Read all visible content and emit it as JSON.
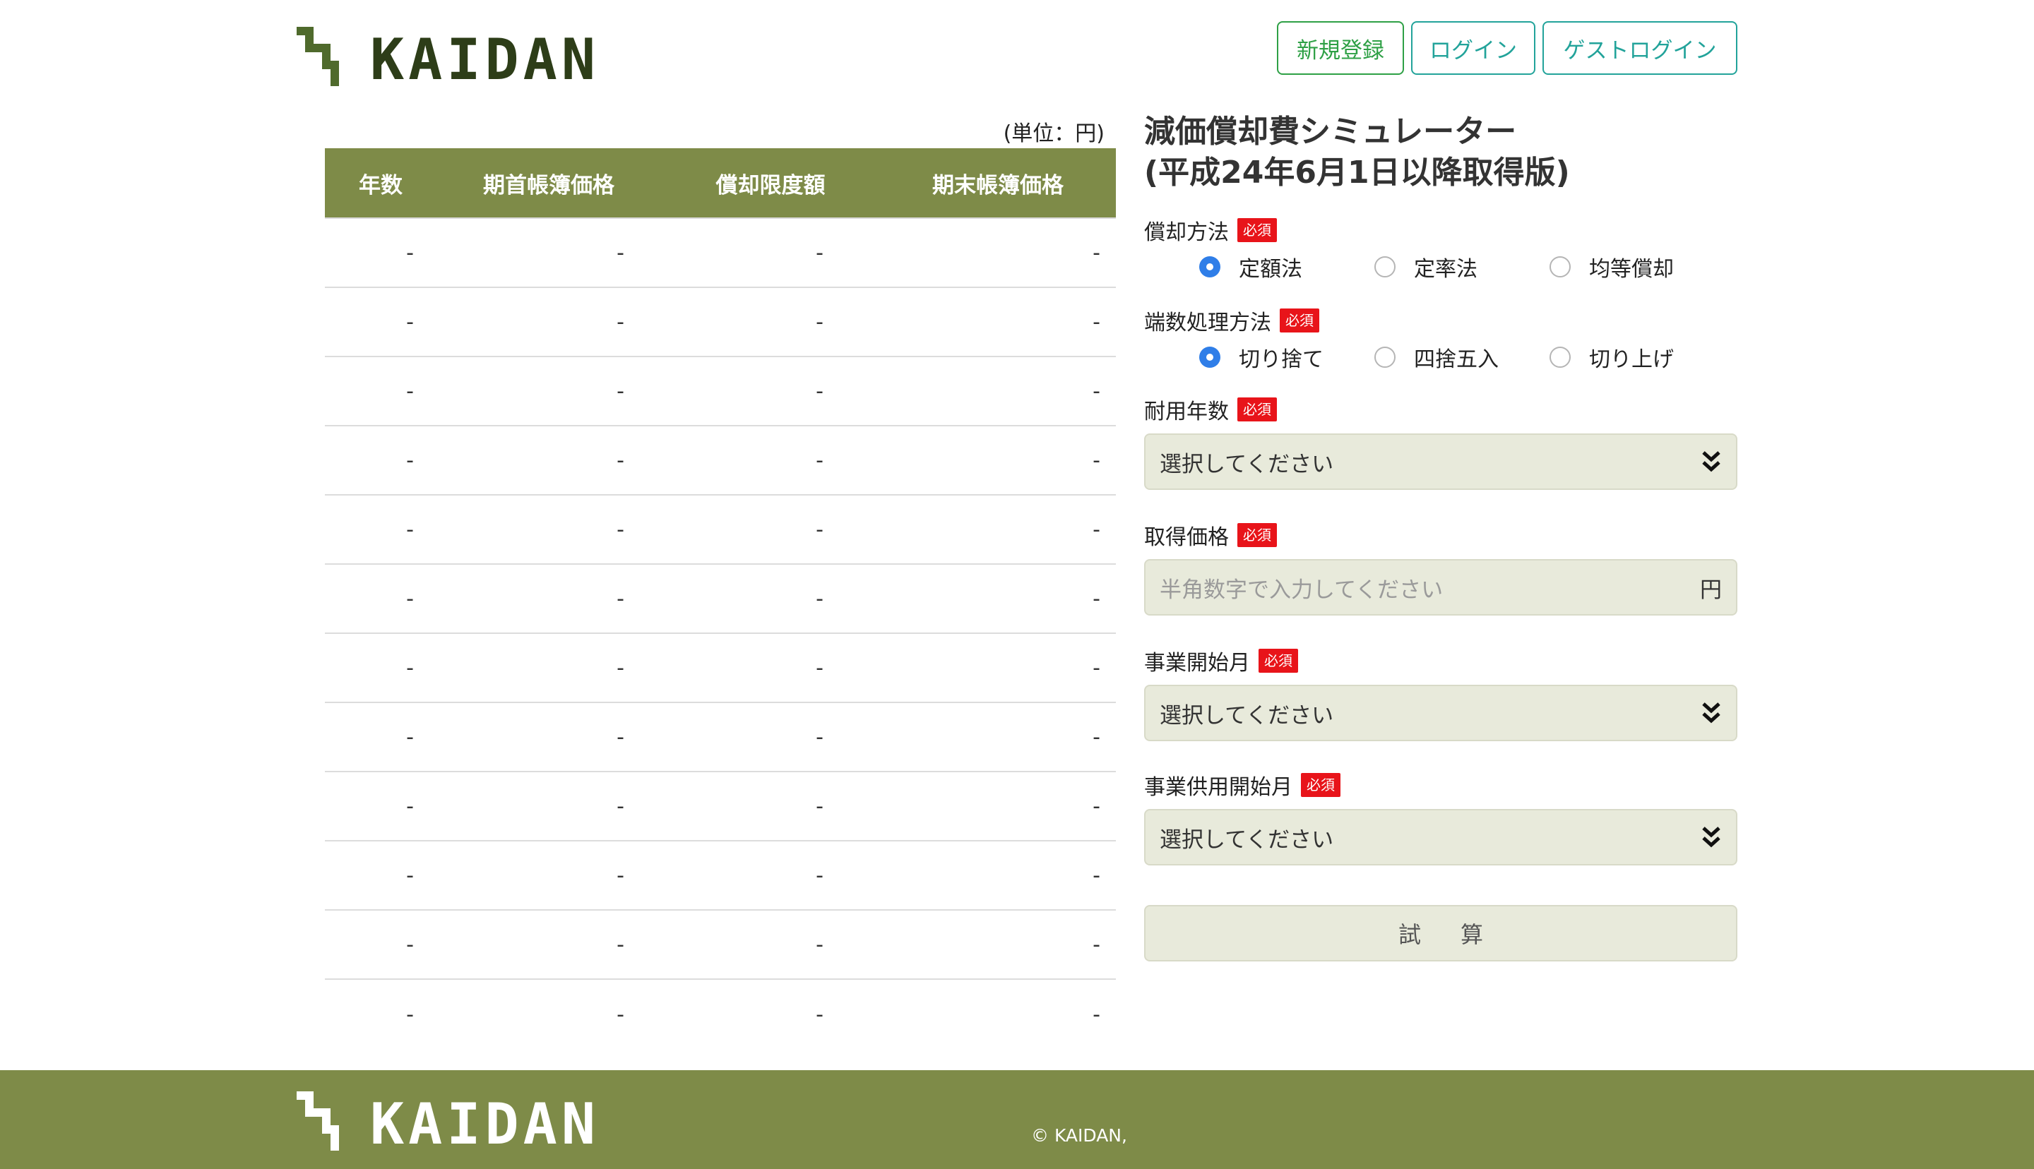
{
  "brand": {
    "name": "KAIDAN",
    "colors": {
      "accent": "#7e8b48",
      "teal": "#22a39a",
      "green": "#2ea045",
      "required": "#e8141a",
      "radio": "#2f7ee8"
    }
  },
  "header": {
    "register_label": "新規登録",
    "login_label": "ログイン",
    "guest_login_label": "ゲストログイン"
  },
  "table": {
    "unit_label": "(単位：円)",
    "headers": [
      "年数",
      "期首帳簿価格",
      "償却限度額",
      "期末帳簿価格"
    ],
    "rows": [
      [
        "-",
        "-",
        "-",
        "-"
      ],
      [
        "-",
        "-",
        "-",
        "-"
      ],
      [
        "-",
        "-",
        "-",
        "-"
      ],
      [
        "-",
        "-",
        "-",
        "-"
      ],
      [
        "-",
        "-",
        "-",
        "-"
      ],
      [
        "-",
        "-",
        "-",
        "-"
      ],
      [
        "-",
        "-",
        "-",
        "-"
      ],
      [
        "-",
        "-",
        "-",
        "-"
      ],
      [
        "-",
        "-",
        "-",
        "-"
      ],
      [
        "-",
        "-",
        "-",
        "-"
      ],
      [
        "-",
        "-",
        "-",
        "-"
      ],
      [
        "-",
        "-",
        "-",
        "-"
      ]
    ]
  },
  "form": {
    "title_line1": "減価償却費シミュレーター",
    "title_line2": "(平成24年6月1日以降取得版)",
    "required_badge": "必須",
    "method": {
      "label": "償却方法",
      "options": [
        "定額法",
        "定率法",
        "均等償却"
      ],
      "selected": "定額法"
    },
    "rounding": {
      "label": "端数処理方法",
      "options": [
        "切り捨て",
        "四捨五入",
        "切り上げ"
      ],
      "selected": "切り捨て"
    },
    "useful_life": {
      "label": "耐用年数",
      "value": "選択してください",
      "icon": "double-chevron-down-icon"
    },
    "acquisition_price": {
      "label": "取得価格",
      "placeholder": "半角数字で入力してください",
      "suffix": "円"
    },
    "business_start_month": {
      "label": "事業開始月",
      "value": "選択してください",
      "icon": "double-chevron-down-icon"
    },
    "service_start_month": {
      "label": "事業供用開始月",
      "value": "選択してください",
      "icon": "double-chevron-down-icon"
    },
    "submit_label": "試算"
  },
  "footer": {
    "copyright": "© KAIDAN,"
  }
}
